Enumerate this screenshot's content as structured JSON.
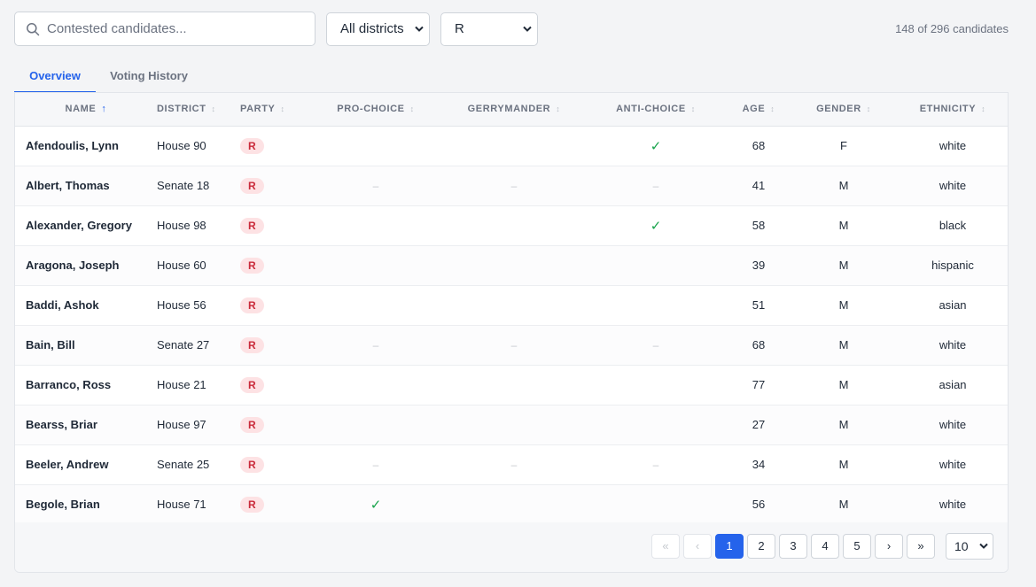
{
  "toolbar": {
    "search_placeholder": "Contested candidates...",
    "district_filter": "All districts",
    "party_filter": "R",
    "result_count": "148 of 296 candidates"
  },
  "tabs": [
    {
      "label": "Overview",
      "active": true
    },
    {
      "label": "Voting History",
      "active": false
    }
  ],
  "table": {
    "columns": [
      "NAME",
      "DISTRICT",
      "PARTY",
      "PRO-CHOICE",
      "GERRYMANDER",
      "ANTI-CHOICE",
      "AGE",
      "GENDER",
      "ETHNICITY"
    ],
    "sorted_by": "NAME",
    "sort_direction_symbol": "↑",
    "unsorted_symbol": "↕",
    "check_symbol": "✓",
    "dash_symbol": "–",
    "rows": [
      {
        "name": "Afendoulis, Lynn",
        "district": "House 90",
        "party": "R",
        "pro_choice": "",
        "gerrymander": "",
        "anti_choice": "check",
        "age": "68",
        "gender": "F",
        "ethnicity": "white"
      },
      {
        "name": "Albert, Thomas",
        "district": "Senate 18",
        "party": "R",
        "pro_choice": "dash",
        "gerrymander": "dash",
        "anti_choice": "dash",
        "age": "41",
        "gender": "M",
        "ethnicity": "white"
      },
      {
        "name": "Alexander, Gregory",
        "district": "House 98",
        "party": "R",
        "pro_choice": "",
        "gerrymander": "",
        "anti_choice": "check",
        "age": "58",
        "gender": "M",
        "ethnicity": "black"
      },
      {
        "name": "Aragona, Joseph",
        "district": "House 60",
        "party": "R",
        "pro_choice": "",
        "gerrymander": "",
        "anti_choice": "",
        "age": "39",
        "gender": "M",
        "ethnicity": "hispanic"
      },
      {
        "name": "Baddi, Ashok",
        "district": "House 56",
        "party": "R",
        "pro_choice": "",
        "gerrymander": "",
        "anti_choice": "",
        "age": "51",
        "gender": "M",
        "ethnicity": "asian"
      },
      {
        "name": "Bain, Bill",
        "district": "Senate 27",
        "party": "R",
        "pro_choice": "dash",
        "gerrymander": "dash",
        "anti_choice": "dash",
        "age": "68",
        "gender": "M",
        "ethnicity": "white"
      },
      {
        "name": "Barranco, Ross",
        "district": "House 21",
        "party": "R",
        "pro_choice": "",
        "gerrymander": "",
        "anti_choice": "",
        "age": "77",
        "gender": "M",
        "ethnicity": "asian"
      },
      {
        "name": "Bearss, Briar",
        "district": "House 97",
        "party": "R",
        "pro_choice": "",
        "gerrymander": "",
        "anti_choice": "",
        "age": "27",
        "gender": "M",
        "ethnicity": "white"
      },
      {
        "name": "Beeler, Andrew",
        "district": "Senate 25",
        "party": "R",
        "pro_choice": "dash",
        "gerrymander": "dash",
        "anti_choice": "dash",
        "age": "34",
        "gender": "M",
        "ethnicity": "white"
      },
      {
        "name": "Begole, Brian",
        "district": "House 71",
        "party": "R",
        "pro_choice": "check",
        "gerrymander": "",
        "anti_choice": "",
        "age": "56",
        "gender": "M",
        "ethnicity": "white"
      }
    ]
  },
  "pagination": {
    "first": "«",
    "prev": "‹",
    "pages": [
      "1",
      "2",
      "3",
      "4",
      "5"
    ],
    "current_page": "1",
    "next": "›",
    "last": "»",
    "per_page": "10"
  },
  "colors": {
    "accent": "#2563eb",
    "party_r_bg": "#fde2e4",
    "party_r_text": "#c92a3a",
    "check": "#16a34a"
  }
}
